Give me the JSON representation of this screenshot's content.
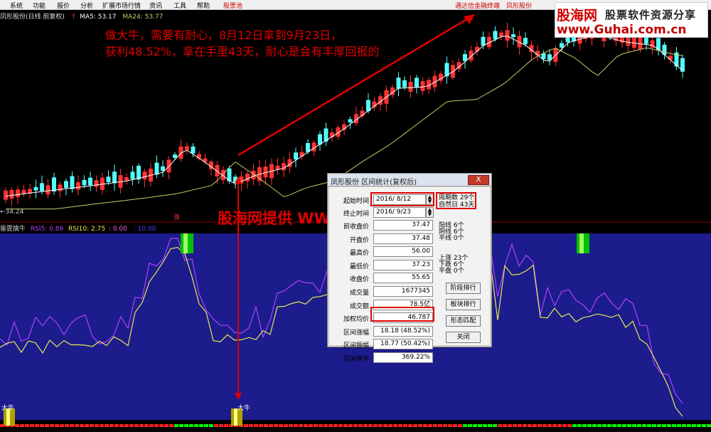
{
  "menu": {
    "items": [
      "系统",
      "功能",
      "报价",
      "分析",
      "扩展市场行情",
      "资讯",
      "工具",
      "帮助"
    ],
    "pool": "股票池",
    "right_items": [
      "通达信金融终端",
      "凤形股份"
    ]
  },
  "watermark": {
    "logo_cn": "股海网",
    "logo_slogan": "股票软件资源分享",
    "logo_url": "www.Guhai.com.cn",
    "center_text": "股海网提供 WWW.Guhai.Com.CN"
  },
  "chart_header": {
    "name": "凤形股份(日线 前复权)",
    "ma5": "MA5: 53.17",
    "ma24": "MA24: 53.77",
    "low_mark": "←34.24",
    "zhang": "涨"
  },
  "annotation": {
    "line1": "做大牛，需要有耐心，8月12日拿到9月23日，",
    "line2": "获利48.52%，拿在手里43天，耐心是会有丰厚回报的"
  },
  "indicator": {
    "name": "雷霆擒牛",
    "rsi5": "RSI5: 0.89",
    "rsi10": "RSI10: 2.75",
    "v3": ": 0.00",
    "v4": ": 10.00",
    "signal_label": "大牛"
  },
  "dialog": {
    "title": "凤形股份 区间统计(复权后)",
    "close_label": "X",
    "start_label": "起始时间",
    "start_value": "2016/ 8/12",
    "end_label": "终止时间",
    "end_value": "2016/ 9/23",
    "rows": [
      {
        "label": "前收盘价",
        "value": "37.47"
      },
      {
        "label": "开盘价",
        "value": "37.48"
      },
      {
        "label": "最高价",
        "value": "56.00"
      },
      {
        "label": "最低价",
        "value": "37.23"
      },
      {
        "label": "收盘价",
        "value": "55.65"
      },
      {
        "label": "成交量",
        "value": "1677345"
      },
      {
        "label": "成交额",
        "value": "78.5亿"
      },
      {
        "label": "加权均价",
        "value": "46.787"
      },
      {
        "label": "区间涨幅",
        "value": "18.18 (48.52%)"
      },
      {
        "label": "区间振幅",
        "value": "18.77 (50.42%)"
      },
      {
        "label": "区间换手",
        "value": "369.22%"
      }
    ],
    "period_count_label": "周期数",
    "period_count_value": "29个",
    "natural_day_label": "自然日",
    "natural_day_value": "43天",
    "yang_label": "阳线",
    "yang_value": "6个",
    "yin_label": "阴线",
    "yin_value": "6个",
    "ping_label": "平线",
    "ping_value": "0个",
    "up_label": "上涨",
    "up_value": "23个",
    "down_label": "下跌",
    "down_value": "6个",
    "flat_label": "平盘",
    "flat_value": "0个",
    "buttons": [
      "阶段排行",
      "板块排行",
      "形态匹配",
      "关闭"
    ]
  },
  "colors": {
    "up_candle": "#ff3232",
    "down_candle": "#54ffff",
    "ma5": "#ffffff",
    "ma24": "#c8c864",
    "rsi5": "#b040ff",
    "rsi10": "#e8e850",
    "indicator_bg": "#1c1c8c",
    "annotation": "#e00000"
  }
}
